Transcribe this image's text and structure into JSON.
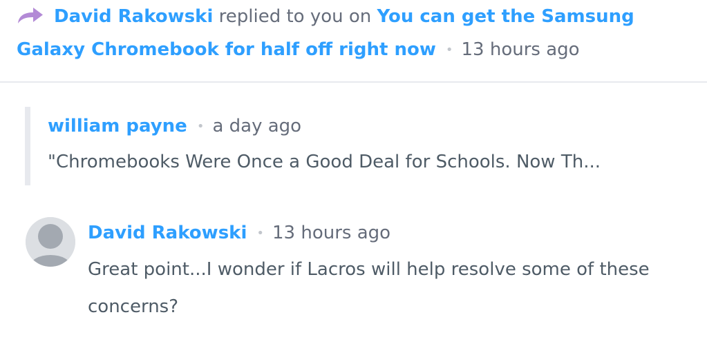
{
  "notification": {
    "icon": "reply-arrow-icon",
    "author": "David Rakowski",
    "action_text": "replied to you on",
    "article_title_line1": "You can get the Samsung",
    "article_title_line2": "Galaxy Chromebook for half off right now",
    "separator": "•",
    "time": "13 hours ago"
  },
  "quoted_comment": {
    "author": "william payne",
    "separator": "•",
    "time": "a day ago",
    "excerpt": "\"Chromebooks Were Once a Good Deal for Schools. Now Th..."
  },
  "reply": {
    "avatar_icon": "default-user-avatar-icon",
    "author": "David Rakowski",
    "separator": "•",
    "time": "13 hours ago",
    "body": "Great point...I wonder if Lacros will help resolve some of these concerns?"
  },
  "colors": {
    "link": "#2e9fff",
    "text": "#4e5b66",
    "muted": "#656c7a",
    "icon_purple": "#b38ad6",
    "divider": "#e7e9ee"
  }
}
